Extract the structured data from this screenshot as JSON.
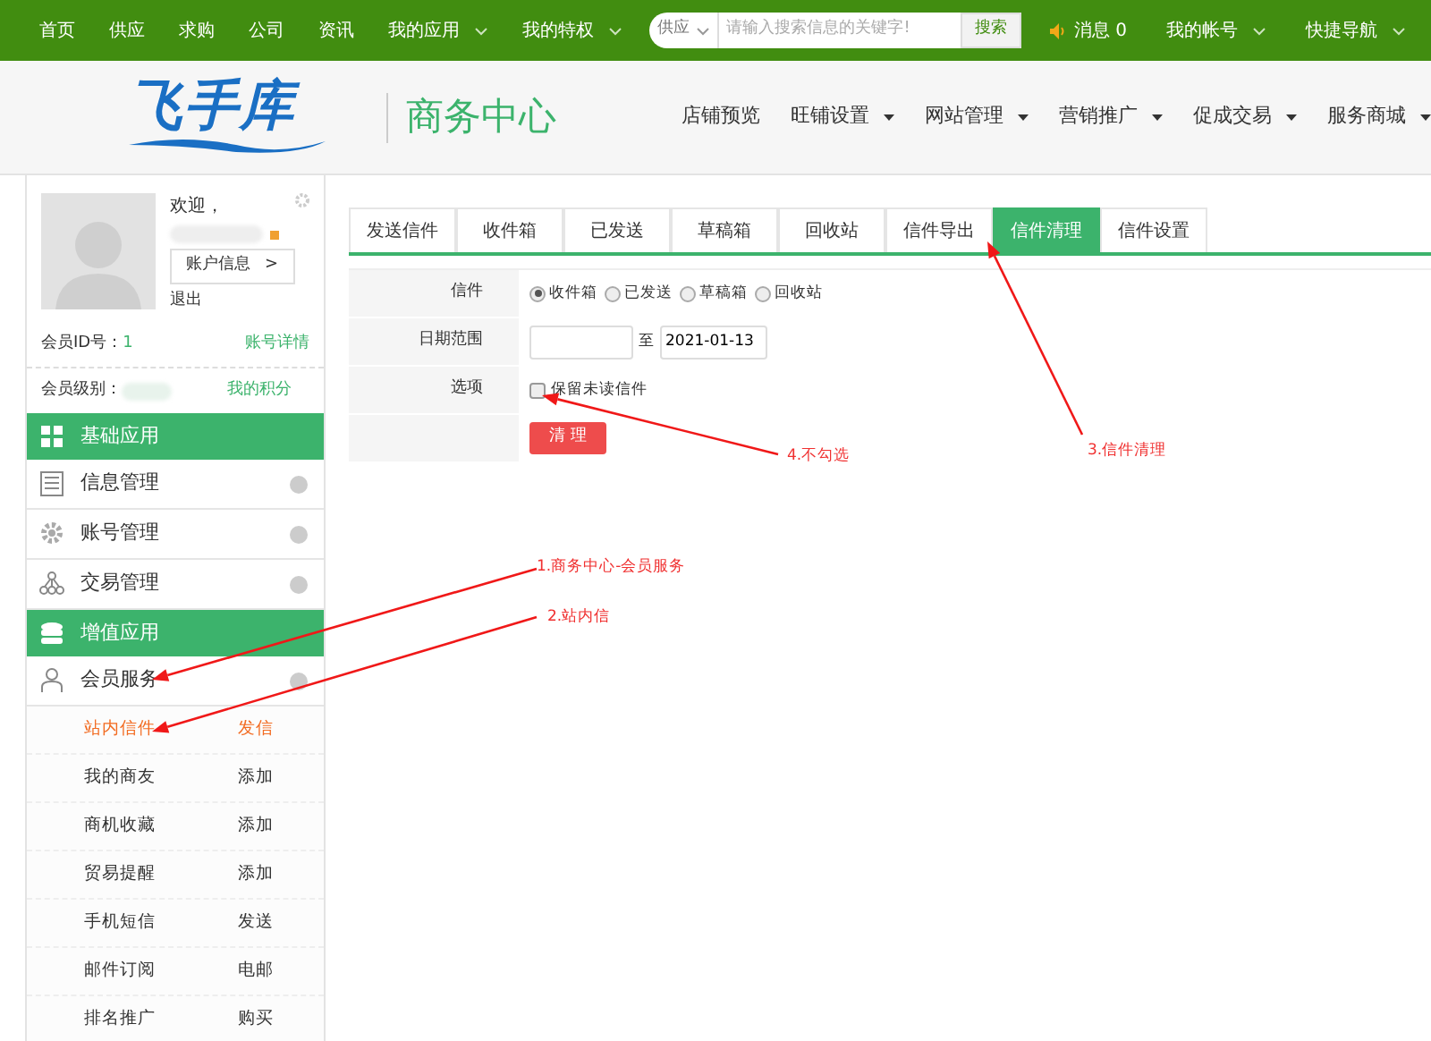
{
  "top_bar": {
    "items": [
      {
        "label": "首页",
        "caret": false
      },
      {
        "label": "供应",
        "caret": false
      },
      {
        "label": "求购",
        "caret": false
      },
      {
        "label": "公司",
        "caret": false
      },
      {
        "label": "资讯",
        "caret": false
      },
      {
        "label": "我的应用",
        "caret": true
      },
      {
        "label": "我的特权",
        "caret": true
      }
    ],
    "search": {
      "category": "供应",
      "placeholder": "请输入搜索信息的关键字!",
      "button": "搜索"
    },
    "messages": {
      "label": "消息",
      "count": "0"
    },
    "right_items": [
      {
        "label": "我的帐号",
        "caret": true
      },
      {
        "label": "快捷导航",
        "caret": true
      }
    ]
  },
  "header": {
    "logo": "飞手库",
    "title": "商务中心",
    "nav": [
      {
        "label": "店铺预览",
        "caret": false
      },
      {
        "label": "旺铺设置",
        "caret": true
      },
      {
        "label": "网站管理",
        "caret": true
      },
      {
        "label": "营销推广",
        "caret": true
      },
      {
        "label": "促成交易",
        "caret": true
      },
      {
        "label": "服务商城",
        "caret": true
      }
    ]
  },
  "sidebar": {
    "welcome": "欢迎，",
    "account_button": "账户信息",
    "account_arrow": ">",
    "logout": "退出",
    "member_id": {
      "label": "会员ID号：",
      "value": "1",
      "link": "账号详情"
    },
    "member_level": {
      "label": "会员级别：",
      "link": "我的积分"
    },
    "menu": [
      {
        "kind": "section",
        "label": "基础应用"
      },
      {
        "kind": "item",
        "label": "信息管理"
      },
      {
        "kind": "item",
        "label": "账号管理"
      },
      {
        "kind": "item",
        "label": "交易管理"
      },
      {
        "kind": "section",
        "label": "增值应用"
      },
      {
        "kind": "item",
        "label": "会员服务"
      },
      {
        "kind": "subitem",
        "label": "站内信件",
        "action": "发信",
        "selected": true
      },
      {
        "kind": "subitem",
        "label": "我的商友",
        "action": "添加",
        "selected": false
      },
      {
        "kind": "subitem",
        "label": "商机收藏",
        "action": "添加",
        "selected": false
      },
      {
        "kind": "subitem",
        "label": "贸易提醒",
        "action": "添加",
        "selected": false
      },
      {
        "kind": "subitem",
        "label": "手机短信",
        "action": "发送",
        "selected": false
      },
      {
        "kind": "subitem",
        "label": "邮件订阅",
        "action": "电邮",
        "selected": false
      },
      {
        "kind": "subitem",
        "label": "排名推广",
        "action": "购买",
        "selected": false
      }
    ]
  },
  "content": {
    "tabs": [
      {
        "label": "发送信件",
        "selected": false
      },
      {
        "label": "收件箱",
        "selected": false
      },
      {
        "label": "已发送",
        "selected": false
      },
      {
        "label": "草稿箱",
        "selected": false
      },
      {
        "label": "回收站",
        "selected": false
      },
      {
        "label": "信件导出",
        "selected": false
      },
      {
        "label": "信件清理",
        "selected": true
      },
      {
        "label": "信件设置",
        "selected": false
      }
    ],
    "form": {
      "mail_label": "信件",
      "mail_types": [
        {
          "label": "收件箱",
          "selected": true
        },
        {
          "label": "已发送",
          "selected": false
        },
        {
          "label": "草稿箱",
          "selected": false
        },
        {
          "label": "回收站",
          "selected": false
        }
      ],
      "date_label": "日期范围",
      "date_separator": "至",
      "date_to": "2021-01-13",
      "option_label": "选项",
      "option": {
        "label": "保留未读信件",
        "checked": false
      },
      "submit": "清 理"
    }
  },
  "annotations": [
    {
      "label": "1.商务中心-会员服务"
    },
    {
      "label": "2.站内信"
    },
    {
      "label": "3.信件清理"
    },
    {
      "label": "4.不勾选"
    }
  ]
}
